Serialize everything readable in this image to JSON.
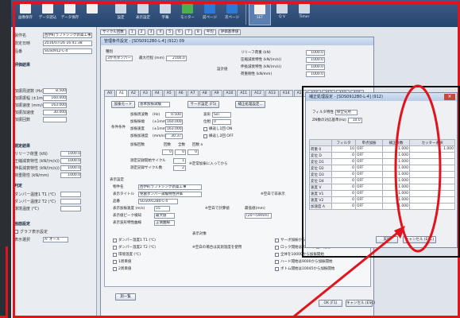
{
  "toolbar": {
    "left_buttons": [
      "画像保存",
      "データ読込",
      "データ保存",
      "",
      "",
      ""
    ],
    "mid_buttons": [
      "設定",
      "表示設定",
      "字幕",
      "モニター",
      "前ページ",
      "次ページ"
    ],
    "right_buttons": [
      "SET",
      "Q V",
      "Timer"
    ]
  },
  "cycle_strip": [
    "サイクル回数",
    "1",
    "2",
    "3",
    "4",
    "5",
    "6",
    "7",
    "8",
    "平均",
    "評価基準値"
  ],
  "left_panel": {
    "rows": [
      {
        "label": "製作名",
        "value": "西伊町ラフトシング新築工事"
      },
      {
        "label": "測定日時",
        "value": "2016/07/26 16:41:38"
      },
      {
        "label": "品番",
        "value": "SGS0912-L-4"
      }
    ],
    "section2_title": "評価結果",
    "rows2": [
      {
        "label": "加振周波数 (Hz)",
        "value": "8.500"
      },
      {
        "label": "加振振幅 (±1mm)",
        "value": "160.000"
      },
      {
        "label": "加振速度 (mm/s)",
        "value": "163.000"
      },
      {
        "label": "加振加速度",
        "value": "30.000"
      },
      {
        "label": "加振回数",
        "value": ""
      }
    ],
    "section3_title": "測定結果",
    "rows3": [
      {
        "label": "リリーフ荷重 (kN)",
        "value": "1000.0"
      },
      {
        "label": "圧縮減衰特性 (kN/(m/s))",
        "value": "1000.0"
      },
      {
        "label": "伸長減衰特性 (kN/(m/s))",
        "value": "1000.0"
      },
      {
        "label": "荷重剛性 (kN/mm)",
        "value": "1000.0"
      }
    ],
    "section4_title": "判定",
    "rows4": [
      {
        "label": "ダンパー温度1 T1 (℃)",
        "value": ""
      },
      {
        "label": "ダンパー温度2 T2 (℃)",
        "value": ""
      },
      {
        "label": "環境温度 (℃)",
        "value": ""
      }
    ],
    "section5_title": "画面設定",
    "rows5": [
      {
        "label": "グラフ表示設定",
        "value": ""
      },
      {
        "label": "表示選択",
        "value": "A: オール"
      }
    ]
  },
  "main_dialog": {
    "title": "管理条件設定 - [SDS0912B0-L-4] (912) 09",
    "kind_label": "種別",
    "kind_value": "3か点ダンパー",
    "stroke_label": "最大行程 (mm)",
    "stroke_value": "2100.0",
    "design_label": "設計値",
    "design_rows": [
      {
        "label": "リリーフ荷重 (kN)",
        "value": "1000.0"
      },
      {
        "label": "圧縮減衰特性 (kN/(m/s))",
        "value": "1000.0"
      },
      {
        "label": "伸長減衰特性 (kN/(m/s))",
        "value": "1000.0"
      },
      {
        "label": "荷重剛性 (kN/mm)",
        "value": "1000.0"
      }
    ],
    "tabs": [
      "A0",
      "A1",
      "A2",
      "A3",
      "A4",
      "A5",
      "A6",
      "A7",
      "A8",
      "A9",
      "A10",
      "A11",
      "A12",
      "A13",
      "A14",
      "A15",
      "A16",
      "A17",
      "A18",
      "A19"
    ],
    "measure_mode_button": "加振モード",
    "mode_value": "基本加振試験",
    "servo_button": "サーボ設定 (F5)",
    "correction_button": "補正処理設定...",
    "condition_label": "条件条件",
    "conditions": [
      {
        "label": "加振周波数",
        "unit": "(Hz)",
        "value": "0.500"
      },
      {
        "label": "加振振幅",
        "unit": "(±1mm)",
        "value": "160.000"
      },
      {
        "label": "加振速度",
        "unit": "(±1mm)",
        "value": "163.000"
      },
      {
        "label": "加振加速度",
        "unit": "(mm/s)",
        "value": "30.37"
      }
    ],
    "wave_label": "波形",
    "wave_value": "Sin",
    "direction_label": "位相",
    "direction_value": "0",
    "recycle_options": [
      "繰返し1回 ON",
      "繰返し2回 OFF"
    ],
    "accel_label": "加振回数",
    "accel_cols": [
      "回数",
      "全数",
      "回数 a"
    ],
    "accel_values": [
      "0",
      "0",
      "0"
    ],
    "cycle_rows": [
      "測定記録開始サイクル",
      "測定記録サイクル数"
    ],
    "cycle_values": [
      "1",
      "2"
    ],
    "cycle_note": "※定常加振に入ってから",
    "display_section": "表示設定",
    "disp_rows": [
      {
        "label": "物件名",
        "value": "西伊町ラフトシング新築工事"
      },
      {
        "label": "表示タイトル",
        "value": "免震ダンパー試験特性評価"
      },
      {
        "label": "品番",
        "value": "SGS0912B0-L-4"
      },
      {
        "label": "表示加振速度 (m/s)",
        "value": "55"
      },
      {
        "label": "表示値ピーク検知",
        "value": "最大値"
      },
      {
        "label": "表示波形特性曲線",
        "value": "正側曲線"
      }
    ],
    "disp_note1": "※空白で非表示",
    "disp_note2": "※空白で計算値",
    "peak_label": "最低値(mm)",
    "peak_range": "(20～59mm)",
    "display_target": "表示対象",
    "target_checks": [
      "ダンパー温度1 T1 (℃)",
      "ダンパー温度2 T2 (℃)",
      "環境温度 (℃)",
      "1周目値",
      "2周目値"
    ],
    "target_note": "※空白の場合は実測温度を使用",
    "right_checks": [
      "サーボ加振から開始する",
      "ロック開始はスムーズ上に開始",
      "全体を10000から加振開始",
      "ハード開始は9000から加振開始",
      "ボトム開始は10045から加振開始"
    ],
    "note_button": "測一覧",
    "ok_button": "OK (F1)",
    "cancel_button": "キャンセル (ESC)"
  },
  "small_dialog": {
    "title": "補正処理設定 - [SDS0912B0-L-4] (912)",
    "filter_label": "フィルタ特性",
    "filter_value": "保全先用",
    "remark_label": "ZN数の対応基準(Hz)",
    "remark_value": "10.0",
    "headers": [
      "フィルタ",
      "単点加振",
      "補正係数",
      "カッター選択"
    ],
    "rows": [
      {
        "name": "荷重 0",
        "v1": "10",
        "sel": "OFF",
        "coef": "1.000",
        "cutter": "1.000"
      },
      {
        "name": "変位 D",
        "v1": "0",
        "sel": "OFF",
        "coef": "1.000",
        "cutter": ""
      },
      {
        "name": "変位 D1",
        "v1": "0",
        "sel": "OFF",
        "coef": "1.000",
        "cutter": ""
      },
      {
        "name": "変位 D2",
        "v1": "0",
        "sel": "OFF",
        "coef": "1.000",
        "cutter": ""
      },
      {
        "name": "変位 D3",
        "v1": "0",
        "sel": "OFF",
        "coef": "1.000",
        "cutter": ""
      },
      {
        "name": "変位 D4",
        "v1": "0",
        "sel": "OFF",
        "coef": "1.000",
        "cutter": ""
      },
      {
        "name": "速度 V",
        "v1": "0",
        "sel": "OFF",
        "coef": "1.000",
        "cutter": ""
      },
      {
        "name": "速度 V1",
        "v1": "0",
        "sel": "OFF",
        "coef": "1.000",
        "cutter": ""
      },
      {
        "name": "速度 V2",
        "v1": "0",
        "sel": "OFF",
        "coef": "1.000",
        "cutter": ""
      },
      {
        "name": "加速度 A",
        "v1": "0",
        "sel": "OFF",
        "coef": "1.000",
        "cutter": ""
      }
    ],
    "ok_button": "実行",
    "cancel_button": "キャンセル (ESC)"
  },
  "colors": {
    "highlight_red": "#e0141c",
    "toolbar_blue": "#27466f"
  }
}
